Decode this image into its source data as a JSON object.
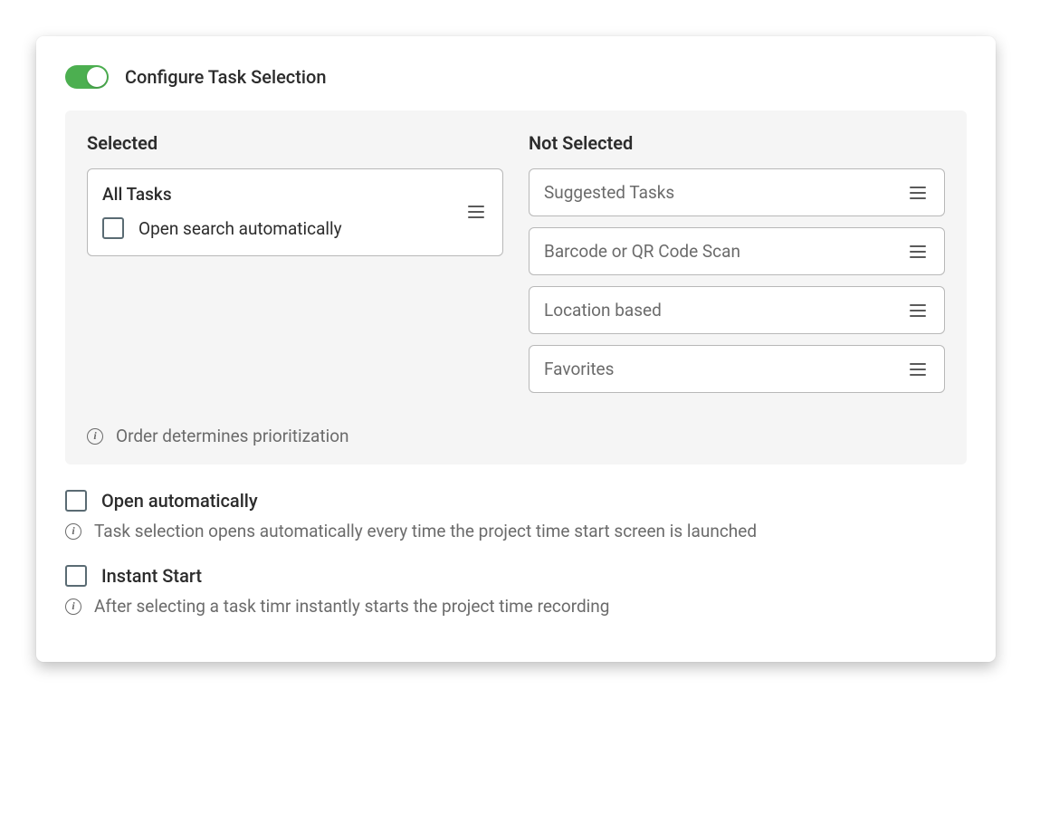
{
  "header": {
    "title": "Configure Task Selection",
    "toggle_on": true
  },
  "panel": {
    "selected_header": "Selected",
    "not_selected_header": "Not Selected",
    "selected_items": [
      {
        "title": "All Tasks",
        "sub_option_label": "Open search automatically"
      }
    ],
    "not_selected_items": [
      {
        "label": "Suggested Tasks"
      },
      {
        "label": "Barcode or QR Code Scan"
      },
      {
        "label": "Location based"
      },
      {
        "label": "Favorites"
      }
    ],
    "footer_hint": "Order determines prioritization"
  },
  "options": [
    {
      "label": "Open automatically",
      "hint": "Task selection opens automatically every time the project time start screen is launched"
    },
    {
      "label": "Instant Start",
      "hint": "After selecting a task timr instantly starts the project time recording"
    }
  ]
}
